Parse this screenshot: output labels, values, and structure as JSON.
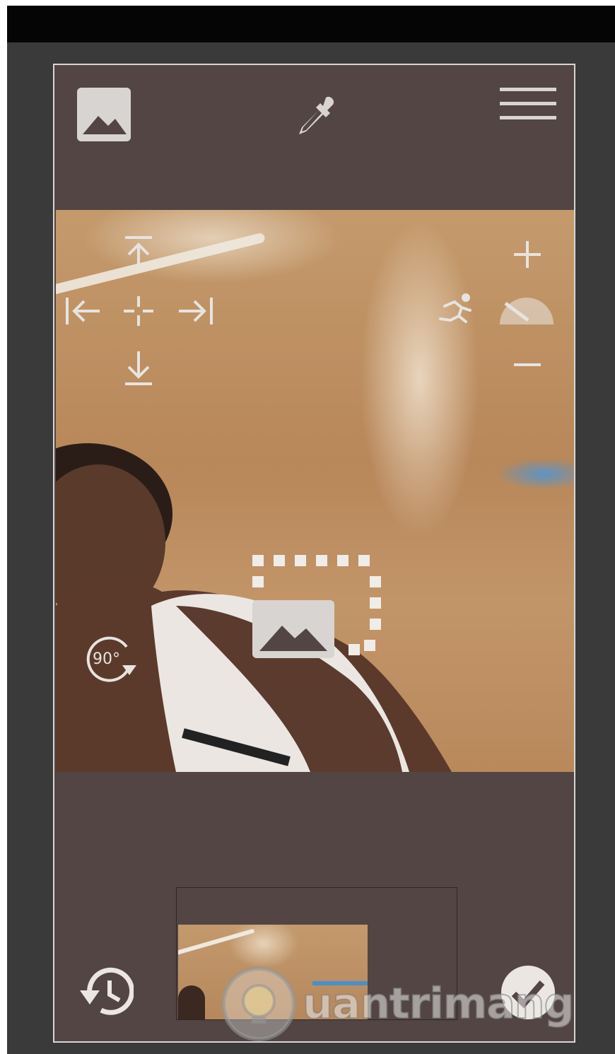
{
  "toolbar": {
    "gallery_icon": "image-icon",
    "picker_icon": "eyedropper-icon",
    "menu_icon": "hamburger-menu-icon"
  },
  "photo_controls": {
    "move_up": "move-to-top-icon",
    "move_left": "move-to-left-icon",
    "move_center": "move-center-icon",
    "move_right": "move-to-right-icon",
    "move_down": "move-to-bottom-icon",
    "zoom_in": "plus-icon",
    "zoom_out": "minus-icon",
    "speed": "running-person-icon",
    "rotate_label": "90°",
    "frame_icon": "image-frame-icon"
  },
  "bottom_bar": {
    "history_icon": "history-icon",
    "confirm_icon": "checkmark-icon"
  },
  "watermark": {
    "text": "uantrimang"
  },
  "colors": {
    "panel": "#524543",
    "border": "#d8d6d4",
    "icon": "#d9d4d0"
  }
}
